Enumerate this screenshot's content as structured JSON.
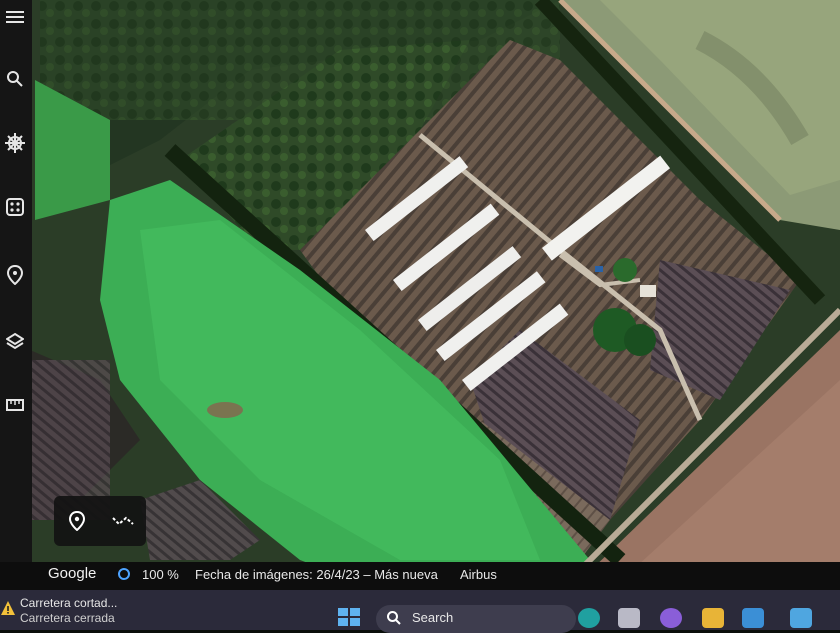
{
  "map": {
    "logo": "Google",
    "zoom_level": "100 %",
    "imagery_date": "Fecha de imágenes: 26/4/23 – Más nueva",
    "provider": "Airbus"
  },
  "toolbar": {
    "items": [
      "menu-icon",
      "search-icon",
      "voyager-icon",
      "dice-icon",
      "place-pin-icon",
      "layers-icon",
      "ruler-icon"
    ]
  },
  "pod": {
    "items": [
      "location-pin-icon",
      "path-icon"
    ]
  },
  "taskbar": {
    "weather_title": "Carretera cortad...",
    "weather_subtitle": "Carretera cerrada",
    "search_label": "Search"
  },
  "colors": {
    "accent": "#4da3ff",
    "toolbar": "#151515",
    "taskbar": "#2b2a3a"
  }
}
